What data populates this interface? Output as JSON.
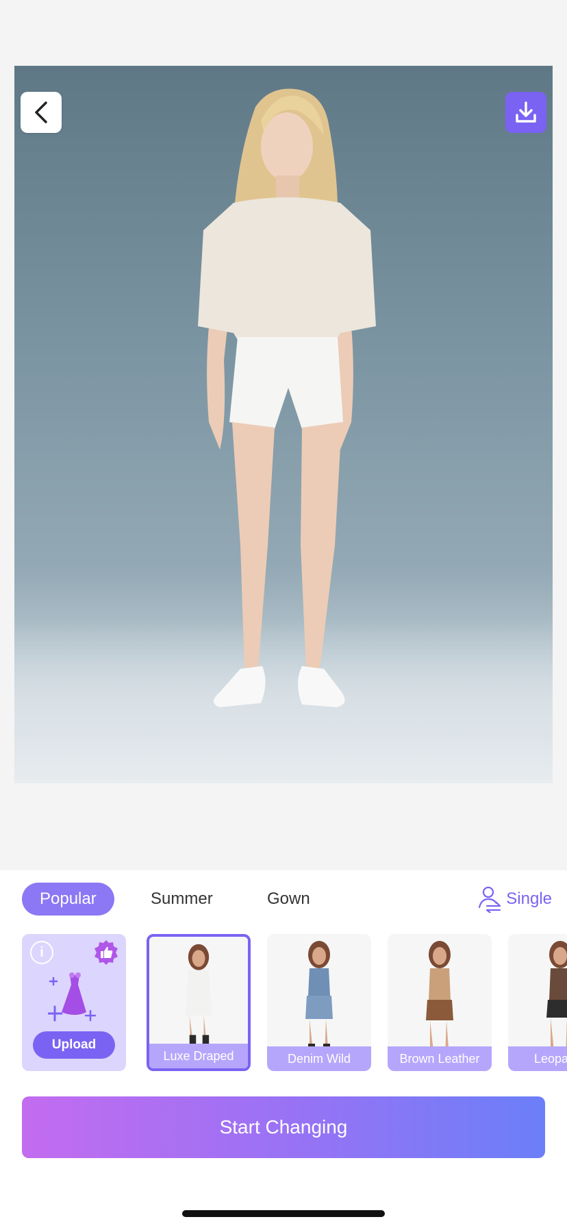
{
  "photo": {
    "alt": ""
  },
  "actions": {
    "back_icon": "chevron-left-icon",
    "download_icon": "download-icon"
  },
  "tabs": [
    {
      "label": "Popular",
      "active": true
    },
    {
      "label": "Summer",
      "active": false
    },
    {
      "label": "Gown",
      "active": false
    }
  ],
  "mode": {
    "label": "Single",
    "icon": "person-switch-icon"
  },
  "upload": {
    "label": "Upload",
    "info_icon": "info-icon",
    "badge_icon": "thumbs-up-badge-icon",
    "art_icon": "dress-sparkle-icon"
  },
  "outfits": [
    {
      "label": "Luxe Draped",
      "selected": true,
      "top_color": "#f2f2f0",
      "bottom_color": "#f2f2f0"
    },
    {
      "label": "Denim Wild",
      "selected": false,
      "top_color": "#6f8fb5",
      "bottom_color": "#7d9cc0"
    },
    {
      "label": "Brown Leather",
      "selected": false,
      "top_color": "#c9a07a",
      "bottom_color": "#8a5a3a"
    },
    {
      "label": "Leopa",
      "selected": false,
      "top_color": "#6a4a3a",
      "bottom_color": "#2d2d2d"
    }
  ],
  "cta": {
    "label": "Start Changing"
  },
  "colors": {
    "accent": "#7a63f2",
    "tab_active": "#8c77f5",
    "card_label": "#b6a6fb",
    "upload_bg": "#dcd5fd"
  }
}
